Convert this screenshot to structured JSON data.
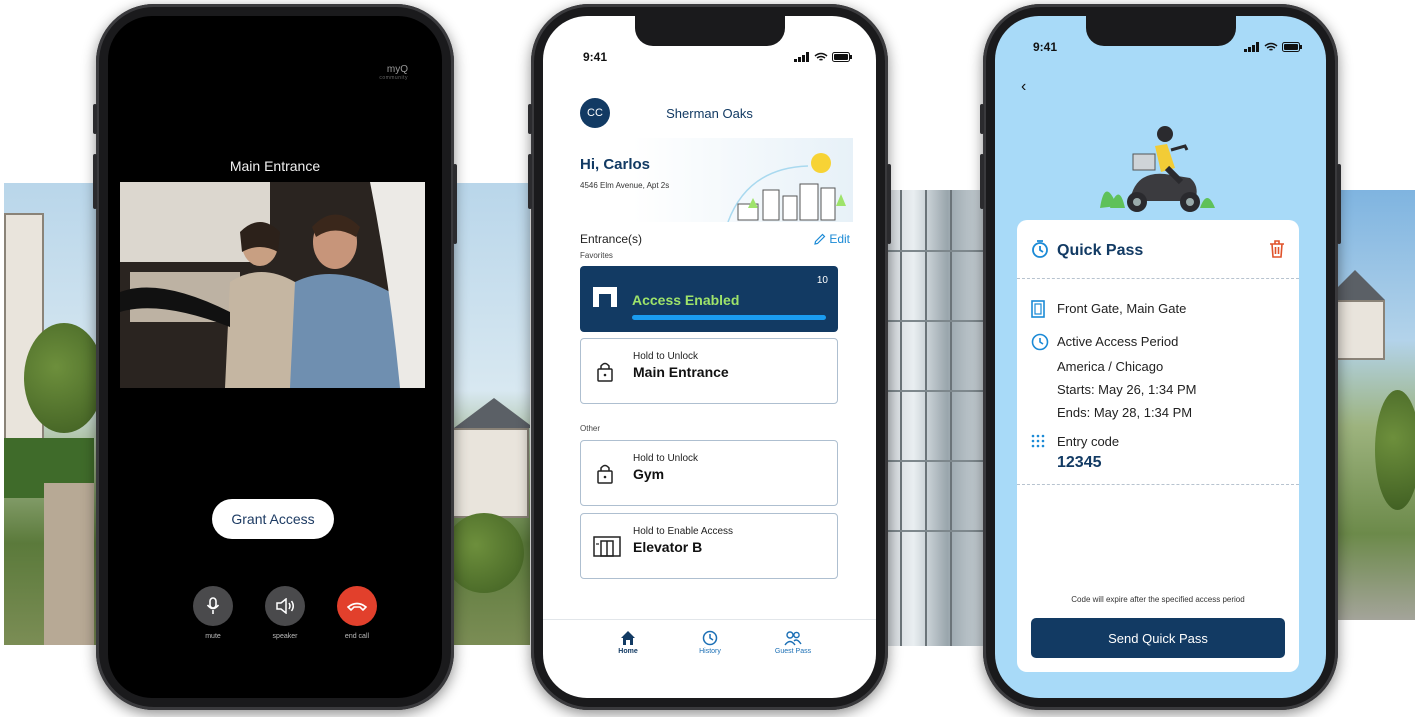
{
  "call_screen": {
    "brand": "myQ",
    "brand_sub": "community",
    "title": "Main Entrance",
    "grant_button": "Grant Access",
    "controls": [
      {
        "label": "mute",
        "icon": "microphone-icon"
      },
      {
        "label": "speaker",
        "icon": "speaker-icon"
      },
      {
        "label": "end call",
        "icon": "end-call-icon",
        "color": "#e2402c"
      }
    ]
  },
  "app_screen": {
    "status_time": "9:41",
    "avatar_initials": "CC",
    "community": "Sherman Oaks",
    "greeting": "Hi, Carlos",
    "address": "4546 Elm Avenue, Apt 2s",
    "entrances_heading": "Entrance(s)",
    "edit_label": "Edit",
    "favorites_label": "Favorites",
    "favorite": {
      "title": "Access Enabled",
      "count": "10"
    },
    "favorite_doors": [
      {
        "hint": "Hold to Unlock",
        "name": "Main Entrance",
        "icon": "lock-icon"
      }
    ],
    "other_label": "Other",
    "other_doors": [
      {
        "hint": "Hold to Unlock",
        "name": "Gym",
        "icon": "lock-icon"
      },
      {
        "hint": "Hold to Enable Access",
        "name": "Elevator B",
        "icon": "elevator-icon"
      }
    ],
    "tabs": [
      {
        "label": "Home",
        "icon": "home-icon",
        "active": true
      },
      {
        "label": "History",
        "icon": "clock-icon",
        "active": false
      },
      {
        "label": "Guest Pass",
        "icon": "people-icon",
        "active": false
      }
    ]
  },
  "quick_pass_screen": {
    "status_time": "9:41",
    "title": "Quick Pass",
    "gates": "Front Gate, Main Gate",
    "period_label": "Active Access Period",
    "timezone": "America / Chicago",
    "starts": "Starts: May 26, 1:34 PM",
    "ends": "Ends: May 28, 1:34 PM",
    "code_label": "Entry code",
    "code": "12345",
    "note": "Code will expire after the specified access period",
    "send_button": "Send Quick Pass"
  },
  "colors": {
    "brand_navy": "#123a63",
    "accent_blue": "#1b8ad6",
    "enabled_green": "#9ee36a",
    "end_call_red": "#e2402c",
    "quick_pass_bg": "#a8daf8",
    "trash_orange": "#e0522a"
  }
}
